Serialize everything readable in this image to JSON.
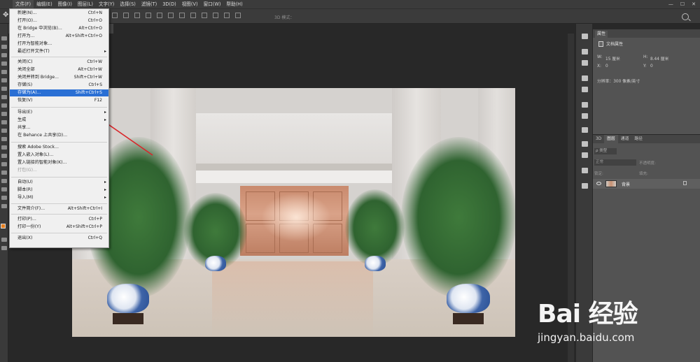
{
  "menubar": {
    "items": [
      "文件(F)",
      "编辑(E)",
      "图像(I)",
      "图层(L)",
      "文字(Y)",
      "选择(S)",
      "滤镜(T)",
      "3D(D)",
      "视图(V)",
      "窗口(W)",
      "帮助(H)"
    ],
    "active_index": 0,
    "window_controls": [
      "—",
      "☐",
      "✕"
    ]
  },
  "optionsbar": {
    "mode_3d_label": "3D 模式："
  },
  "file_menu": {
    "items": [
      {
        "label": "新建(N)...",
        "shortcut": "Ctrl+N"
      },
      {
        "label": "打开(O)...",
        "shortcut": "Ctrl+O"
      },
      {
        "label": "在 Bridge 中浏览(B)...",
        "shortcut": "Alt+Ctrl+O"
      },
      {
        "label": "打开为...",
        "shortcut": "Alt+Shift+Ctrl+O"
      },
      {
        "label": "打开为智能对象...",
        "shortcut": ""
      },
      {
        "label": "最近打开文件(T)",
        "shortcut": "",
        "submenu": true
      },
      {
        "label": "关闭(C)",
        "shortcut": "Ctrl+W"
      },
      {
        "label": "关闭全部",
        "shortcut": "Alt+Ctrl+W"
      },
      {
        "label": "关闭并转到 Bridge...",
        "shortcut": "Shift+Ctrl+W"
      },
      {
        "label": "存储(S)",
        "shortcut": "Ctrl+S"
      },
      {
        "label": "存储为(A)...",
        "shortcut": "Shift+Ctrl+S",
        "selected": true
      },
      {
        "label": "恢复(V)",
        "shortcut": "F12"
      },
      {
        "label": "导出(E)",
        "shortcut": "",
        "submenu": true
      },
      {
        "label": "生成",
        "shortcut": "",
        "submenu": true
      },
      {
        "label": "共享...",
        "shortcut": ""
      },
      {
        "label": "在 Behance 上共享(D)...",
        "shortcut": ""
      },
      {
        "label": "搜索 Adobe Stock...",
        "shortcut": ""
      },
      {
        "label": "置入嵌入对象(L)...",
        "shortcut": ""
      },
      {
        "label": "置入链接的智能对象(K)...",
        "shortcut": ""
      },
      {
        "label": "打包(G)...",
        "shortcut": "",
        "disabled": true
      },
      {
        "label": "自动(U)",
        "shortcut": "",
        "submenu": true
      },
      {
        "label": "脚本(R)",
        "shortcut": "",
        "submenu": true
      },
      {
        "label": "导入(M)",
        "shortcut": "",
        "submenu": true
      },
      {
        "label": "文件简介(F)...",
        "shortcut": "Alt+Shift+Ctrl+I"
      },
      {
        "label": "打印(P)...",
        "shortcut": "Ctrl+P"
      },
      {
        "label": "打印一份(Y)",
        "shortcut": "Alt+Shift+Ctrl+P"
      },
      {
        "label": "退出(X)",
        "shortcut": "Ctrl+Q"
      }
    ],
    "submenu_glyph": "▸"
  },
  "properties_panel": {
    "tab_label": "属性",
    "doc_label": "文档属性",
    "width_label": "W:",
    "width_value": "15 厘米",
    "height_label": "H:",
    "height_value": "8.44 厘米",
    "x_label": "X:",
    "x_value": "0",
    "y_label": "Y:",
    "y_value": "0",
    "resolution_text": "分辨率：300 像素/英寸"
  },
  "layers_panel": {
    "tabs": [
      "3D",
      "图层",
      "通道",
      "路径"
    ],
    "active_tab": 1,
    "filter_label": "ρ 类型",
    "blend_mode": "正常",
    "opacity_label": "不透明度:",
    "lock_label": "锁定:",
    "fill_label": "填充:",
    "layer_name": "背景"
  },
  "watermark": {
    "logo_text": "Bai 经验",
    "site_text": "jingyan.baidu.com"
  },
  "colors": {
    "menu_selected": "#2a6fd4",
    "foreground_color": "#e87f1d",
    "arrow": "#d9262a"
  }
}
